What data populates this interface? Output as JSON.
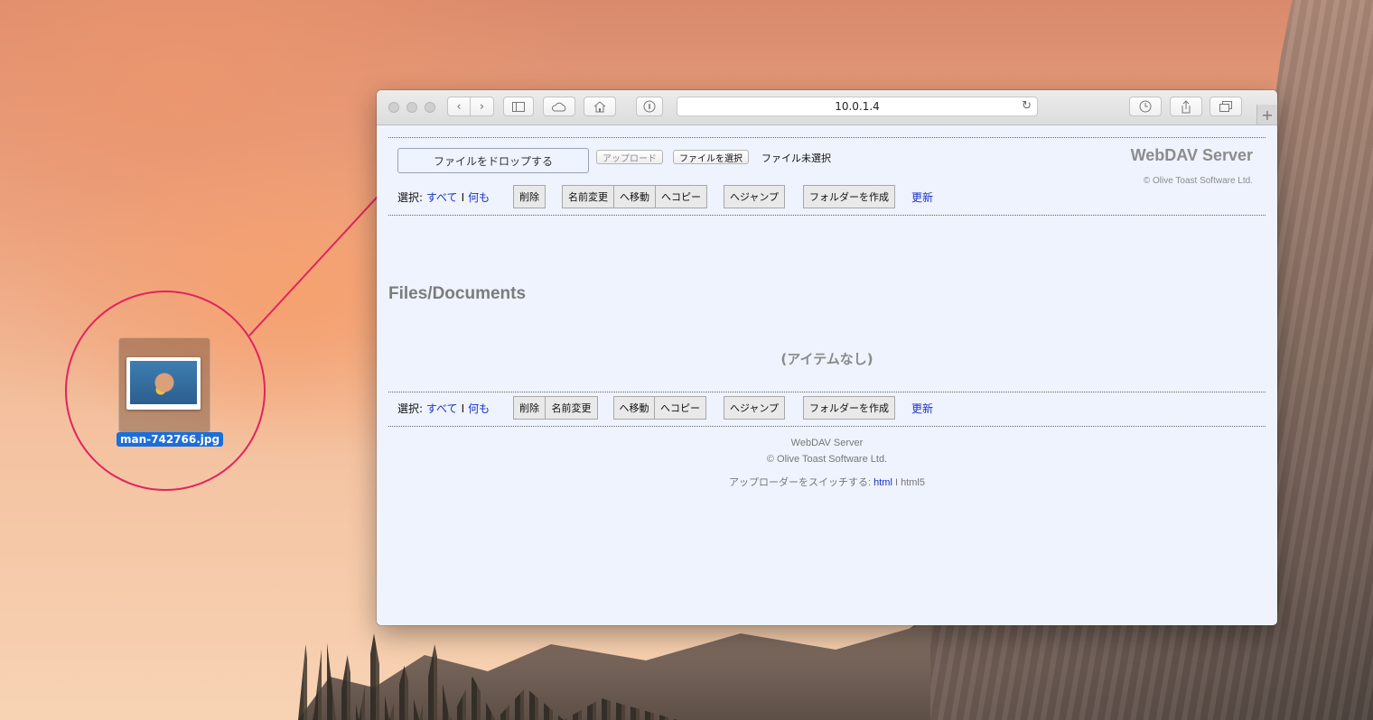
{
  "desktop": {
    "file_name": "man-742766.jpg"
  },
  "browser": {
    "url": "10.0.1.4",
    "new_tab_symbol": "+"
  },
  "header": {
    "drop_zone_label": "ファイルをドロップする",
    "upload_button": "アップロード",
    "choose_file_button": "ファイルを選択",
    "no_file_text": "ファイル未選択",
    "brand_title": "WebDAV Server",
    "brand_copyright": "© Olive Toast Software Ltd."
  },
  "toolbar_top": {
    "select_label": "選択:",
    "select_all": "すべて",
    "separator": "I",
    "select_none": "何も",
    "delete": "削除",
    "rename": "名前変更",
    "move": "へ移動",
    "copy": "へコピー",
    "jump": "へジャンプ",
    "create_folder": "フォルダーを作成",
    "refresh": "更新"
  },
  "main": {
    "folder_path": "Files/Documents",
    "empty_message": "(アイテムなし)"
  },
  "toolbar_bottom": {
    "select_label": "選択:",
    "select_all": "すべて",
    "separator": "I",
    "select_none": "何も",
    "delete": "削除",
    "rename": "名前変更",
    "move": "へ移動",
    "copy": "へコピー",
    "jump": "へジャンプ",
    "create_folder": "フォルダーを作成",
    "refresh": "更新"
  },
  "footer": {
    "server_name": "WebDAV Server",
    "copyright": "© Olive Toast Software Ltd.",
    "switch_label": "アップローダーをスイッチする:",
    "html_link": "html",
    "separator": "I",
    "html5_text": "html5"
  },
  "colors": {
    "annotation": "#e0245e",
    "link": "#1a32c8",
    "selection": "#1d6ed8"
  }
}
